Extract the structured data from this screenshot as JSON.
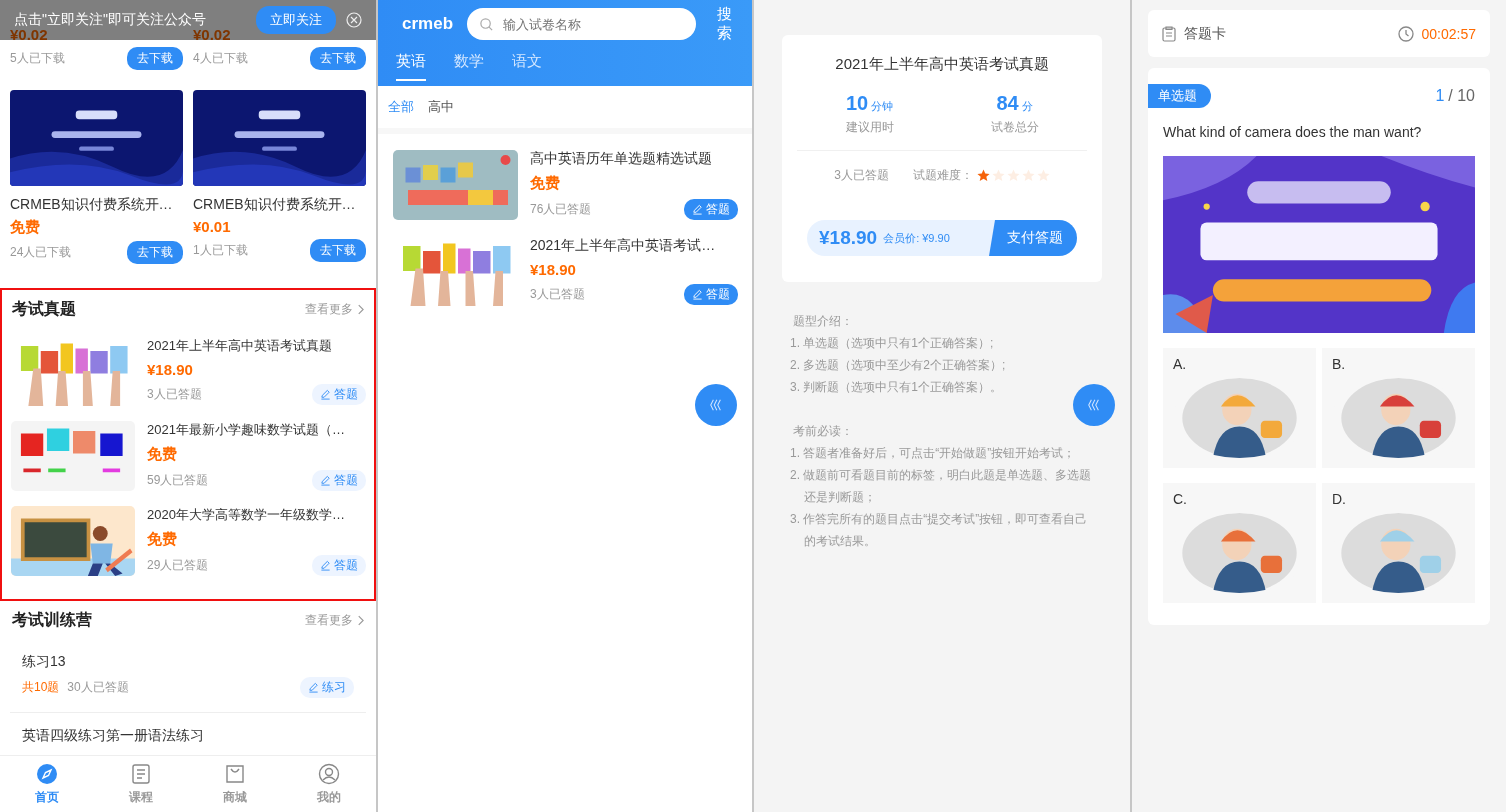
{
  "home": {
    "follow_bar": {
      "text": "点击\"立即关注\"即可关注公众号",
      "button": "立即关注"
    },
    "downloads": [
      {
        "kind": "cut",
        "price": "¥0.02",
        "count": "5人已下载",
        "button": "去下载"
      },
      {
        "kind": "cut",
        "price": "¥0.02",
        "count": "4人已下载",
        "button": "去下载"
      },
      {
        "kind": "card",
        "title": "CRMEB知识付费系统开…",
        "price": "免费",
        "count": "24人已下载",
        "button": "去下载"
      },
      {
        "kind": "card",
        "title": "CRMEB知识付费系统开…",
        "price": "¥0.01",
        "count": "1人已下载",
        "button": "去下载"
      }
    ],
    "exam_section": {
      "title": "考试真题",
      "more": "查看更多",
      "highlighted": true,
      "items": [
        {
          "title": "2021年上半年高中英语考试真题",
          "price": "¥18.90",
          "count": "3人已答题",
          "button": "答题"
        },
        {
          "title": "2021年最新小学趣味数学试题（…",
          "price": "免费",
          "count": "59人已答题",
          "button": "答题"
        },
        {
          "title": "2020年大学高等数学一年级数学…",
          "price": "免费",
          "count": "29人已答题",
          "button": "答题"
        }
      ]
    },
    "camp_section": {
      "title": "考试训练营",
      "more": "查看更多",
      "items": [
        {
          "title": "练习13",
          "total": "共10题",
          "count": "30人已答题",
          "button": "练习"
        },
        {
          "title": "英语四级练习第一册语法练习"
        }
      ]
    },
    "tab_bar": [
      {
        "label": "首页",
        "selected": true
      },
      {
        "label": "课程",
        "selected": false
      },
      {
        "label": "商城",
        "selected": false
      },
      {
        "label": "我的",
        "selected": false
      }
    ]
  },
  "search_page": {
    "logo": "crmeb",
    "search": {
      "placeholder": "输入试卷名称"
    },
    "search_button": "搜索",
    "tabs": [
      {
        "label": "英语",
        "selected": true
      },
      {
        "label": "数学",
        "selected": false
      },
      {
        "label": "语文",
        "selected": false
      }
    ],
    "filters": [
      {
        "label": "全部",
        "selected": true
      },
      {
        "label": "高中",
        "selected": false
      }
    ],
    "items": [
      {
        "title": "高中英语历年单选题精选试题",
        "price": "免费",
        "count": "76人已答题",
        "button": "答题"
      },
      {
        "title": "2021年上半年高中英语考试…",
        "price": "¥18.90",
        "count": "3人已答题",
        "button": "答题"
      }
    ]
  },
  "detail": {
    "title": "2021年上半年高中英语考试真题",
    "stats": [
      {
        "value": "10",
        "unit": "分钟",
        "label": "建议用时"
      },
      {
        "value": "84",
        "unit": "分",
        "label": "试卷总分"
      }
    ],
    "answered": "3人已答题",
    "difficulty_label": "试题难度：",
    "stars": 1,
    "price": "¥18.90",
    "member_price": "会员价: ¥9.90",
    "pay_button": "支付答题",
    "intro_title": "题型介绍：",
    "intro_lines": [
      "1. 单选题（选项中只有1个正确答案）;",
      "2. 多选题（选项中至少有2个正确答案）;",
      "3. 判断题（选项中只有1个正确答案）。"
    ],
    "notes_title": "考前必读：",
    "notes_lines": [
      "1. 答题者准备好后，可点击“开始做题”按钮开始考试；",
      "2. 做题前可看题目前的标签，明白此题是单选题、多选题还是判断题；",
      "3. 作答完所有的题目点击“提交考试”按钮，即可查看自己的考试结果。"
    ]
  },
  "quiz": {
    "card_label": "答题卡",
    "timer": "00:02:57",
    "type_tag": "单选题",
    "current": "1",
    "total": "/ 10",
    "question": "What kind of camera does the man want?",
    "options": [
      {
        "label": "A."
      },
      {
        "label": "B."
      },
      {
        "label": "C."
      },
      {
        "label": "D."
      }
    ]
  }
}
